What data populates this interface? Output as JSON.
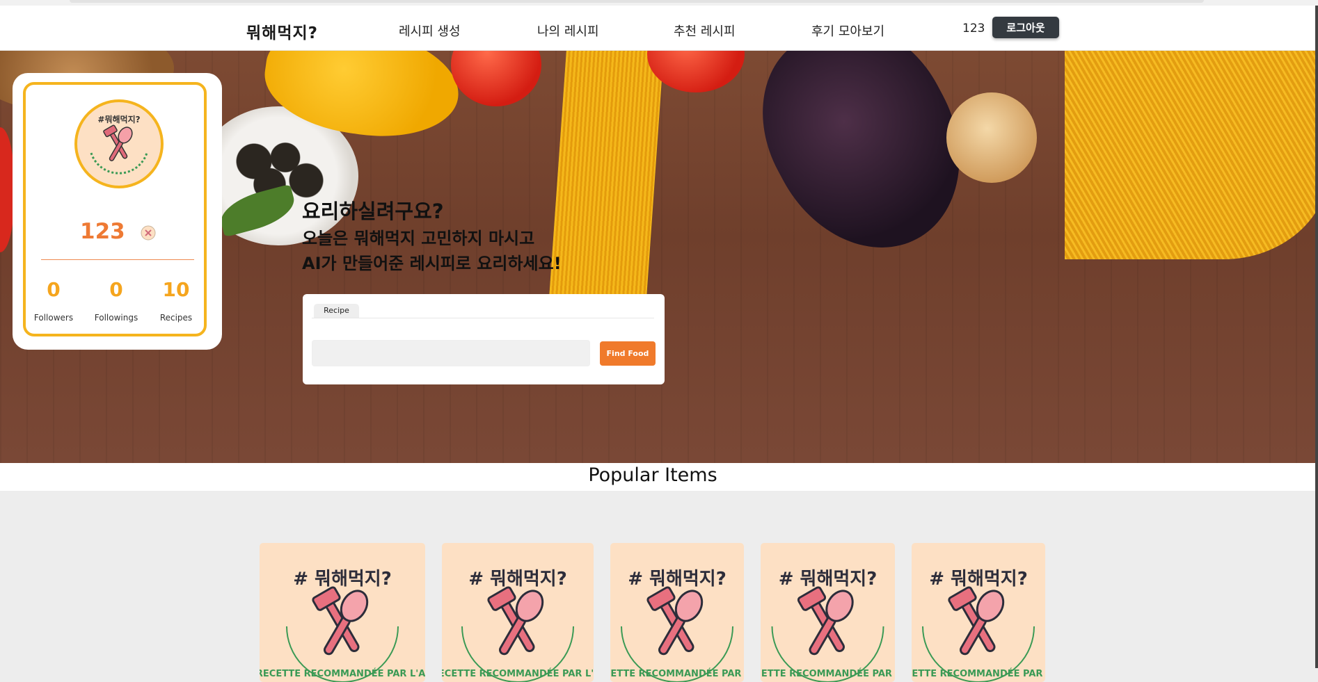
{
  "nav": {
    "brand": "뭐해먹지?",
    "links": [
      "레시피 생성",
      "나의 레시피",
      "추천 레시피",
      "후기 모아보기"
    ],
    "username": "123",
    "logout_label": "로그아웃"
  },
  "hero": {
    "title": "요리하실려구요?",
    "subtitle_line1": "오늘은 뭐해먹지 고민하지 마시고",
    "subtitle_line2": "AI가 만들어준 레시피로 요리하세요!"
  },
  "search": {
    "tab_label": "Recipe",
    "input_value": "",
    "button_label": "Find Food"
  },
  "profile": {
    "avatar_icon": "logo-fork-spoon-icon",
    "username": "123",
    "stats": [
      {
        "value": "0",
        "label": "Followers"
      },
      {
        "value": "0",
        "label": "Followings"
      },
      {
        "value": "10",
        "label": "Recipes"
      }
    ]
  },
  "popular": {
    "title": "Popular Items",
    "item_count": 5,
    "item_icon": "logo-fork-spoon-icon"
  },
  "logo": {
    "text_top": "# 뭐해먹지?",
    "text_bottom": "RECETTE RECOMMANDÉE PAR L'AI"
  },
  "colors": {
    "accent_orange": "#f07a2b",
    "accent_yellow": "#f5b41e",
    "dark_button": "#343a40",
    "logo_bg": "#fde0c4"
  }
}
